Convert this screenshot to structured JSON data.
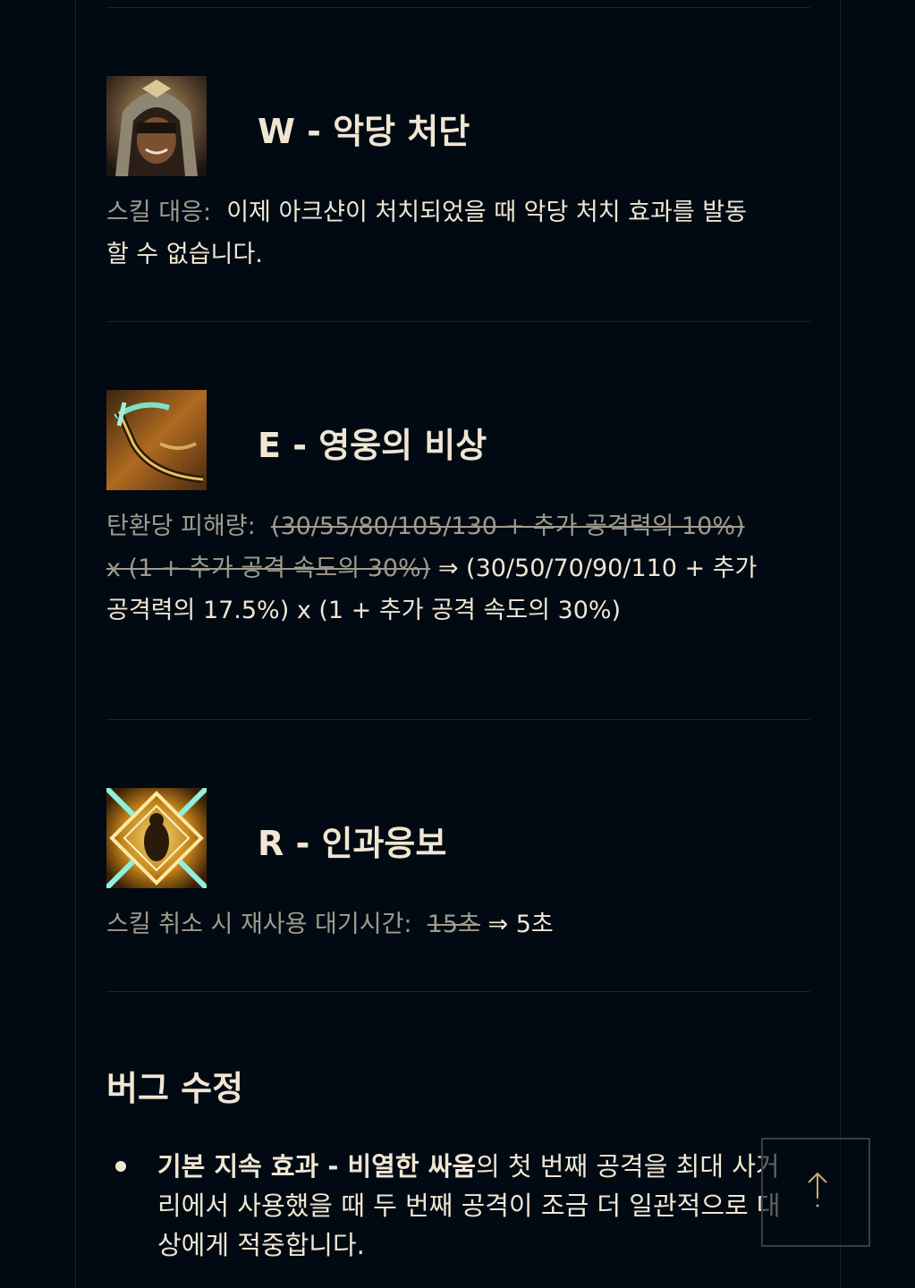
{
  "skills": [
    {
      "key": "W",
      "title": "W - 악당 처단",
      "icon": "villain-execution-icon",
      "label": "스킬 대응:",
      "text": "이제 아크샨이 처치되었을 때 악당 처치 효과를 발동할 수 없습니다."
    },
    {
      "key": "E",
      "title": "E - 영웅의 비상",
      "icon": "heroic-swing-icon",
      "label": "탄환당 피해량:",
      "old_value": "(30/55/80/105/130 + 추가 공격력의 10%) x (1 + 추가 공격 속도의 30%)",
      "arrow": "⇒",
      "new_value": "(30/50/70/90/110 + 추가 공격력의 17.5%) x (1 + 추가 공격 속도의 30%)"
    },
    {
      "key": "R",
      "title": "R - 인과응보",
      "icon": "comeuppance-icon",
      "label": "스킬 취소 시 재사용 대기시간:",
      "old_value": "15초",
      "arrow": "⇒",
      "new_value": "5초"
    }
  ],
  "bugfix": {
    "title": "버그 수정",
    "items": [
      {
        "bold": "기본 지속 효과 - 비열한 싸움",
        "text": "의 첫 번째 공격을 최대 사거리에서 사용했을 때 두 번째 공격이 조금 더 일관적으로 대상에게 적중합니다."
      }
    ]
  },
  "scroll_top": {
    "icon": "arrow-up-icon"
  }
}
